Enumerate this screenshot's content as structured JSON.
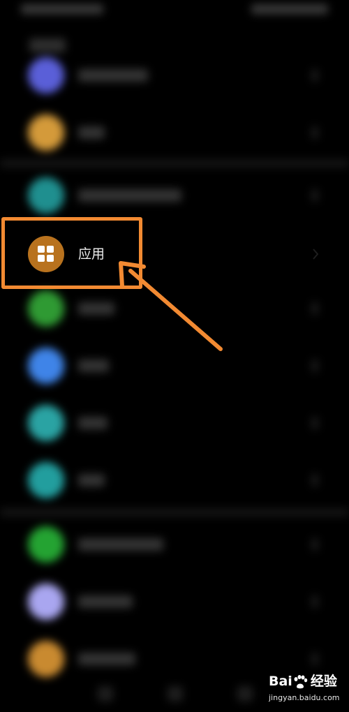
{
  "focused_item": {
    "label": "应用",
    "icon": "grid-four-squares-icon",
    "icon_color": "#b8721e"
  },
  "blurred_rows": [
    {
      "icon_color": "#5a5fd8",
      "text_width": 100
    },
    {
      "icon_color": "#d49a3a",
      "text_width": 38
    },
    {
      "icon_color": "#1f8f8f",
      "text_width": 148
    },
    {
      "icon_color": "#2f9a33",
      "text_width": 52
    },
    {
      "icon_color": "#3f84e8",
      "text_width": 44
    },
    {
      "icon_color": "#2aa3a3",
      "text_width": 42
    },
    {
      "icon_color": "#229e9e",
      "text_width": 38
    },
    {
      "icon_color": "#24a332",
      "text_width": 122
    },
    {
      "icon_color": "#a9a6f0",
      "text_width": 78
    },
    {
      "icon_color": "#c98a30",
      "text_width": 82
    }
  ],
  "annotation": {
    "box_color": "#f28a32",
    "arrow_color": "#f28a32"
  },
  "watermark": {
    "brand_prefix": "Bai",
    "brand_suffix": "经验",
    "url": "jingyan.baidu.com",
    "paw_icon": "baidu-paw-icon"
  }
}
